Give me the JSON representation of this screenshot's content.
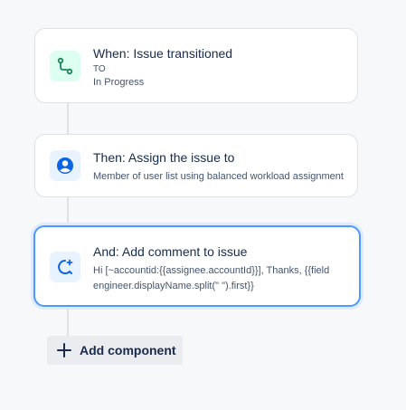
{
  "rule": {
    "trigger": {
      "title": "When: Issue transitioned",
      "from_label": "TO",
      "to_status": "In Progress",
      "icon": "transition-icon",
      "icon_color": "#1f845a"
    },
    "action_assign": {
      "title": "Then: Assign the issue to",
      "description": "Member of user list using balanced workload assignment",
      "icon": "user-avatar-icon",
      "icon_color": "#0c66e4"
    },
    "action_comment": {
      "title": "And: Add comment to issue",
      "comment_line1": "Hi [~accountid:{{assignee.accountId}}], Thanks, {{field",
      "comment_line2": "engineer.displayName.split(\" \").first}}",
      "icon": "comment-add-icon",
      "icon_color": "#0c66e4"
    },
    "add_component_label": "Add component"
  },
  "colors": {
    "selected_border": "#4c9aff",
    "connector": "#dfe1e6"
  }
}
